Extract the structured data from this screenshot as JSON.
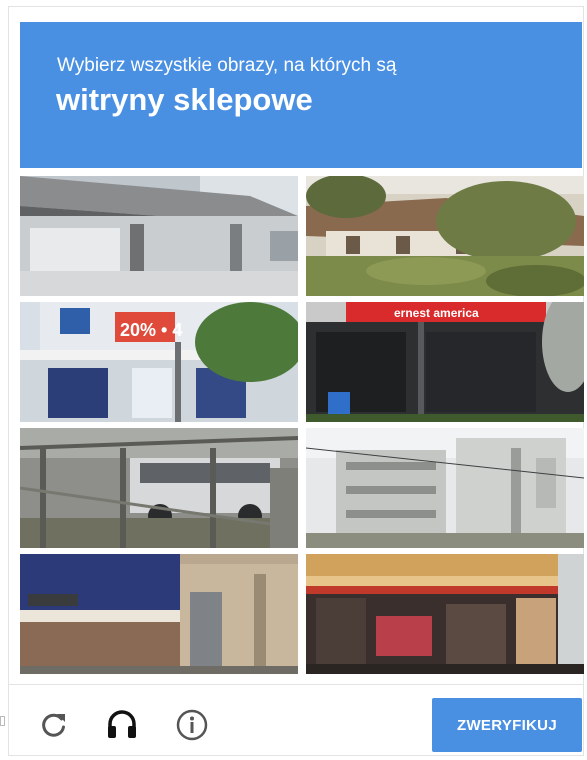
{
  "header": {
    "instruction": "Wybierz wszystkie obrazy, na których są",
    "subject": "witryny sklepowe",
    "color": "#4a90e2"
  },
  "tiles": [
    {
      "name": "tile-1",
      "description_icon": "building-awning-image"
    },
    {
      "name": "tile-2",
      "description_icon": "house-trees-image"
    },
    {
      "name": "tile-3",
      "description_icon": "storefront-sign-image"
    },
    {
      "name": "tile-4",
      "description_icon": "store-red-sign-image"
    },
    {
      "name": "tile-5",
      "description_icon": "fence-car-image"
    },
    {
      "name": "tile-6",
      "description_icon": "apartment-building-image"
    },
    {
      "name": "tile-7",
      "description_icon": "brick-wall-gate-image"
    },
    {
      "name": "tile-8",
      "description_icon": "shop-front-image"
    }
  ],
  "store_signs": {
    "tile3_promo": "20% • 4",
    "tile4_sign": "ernest america"
  },
  "footer": {
    "reload_icon": "reload-icon",
    "audio_icon": "headphones-icon",
    "info_icon": "info-icon",
    "verify_label": "ZWERYFIKUJ",
    "accent": "#4a90e2"
  }
}
